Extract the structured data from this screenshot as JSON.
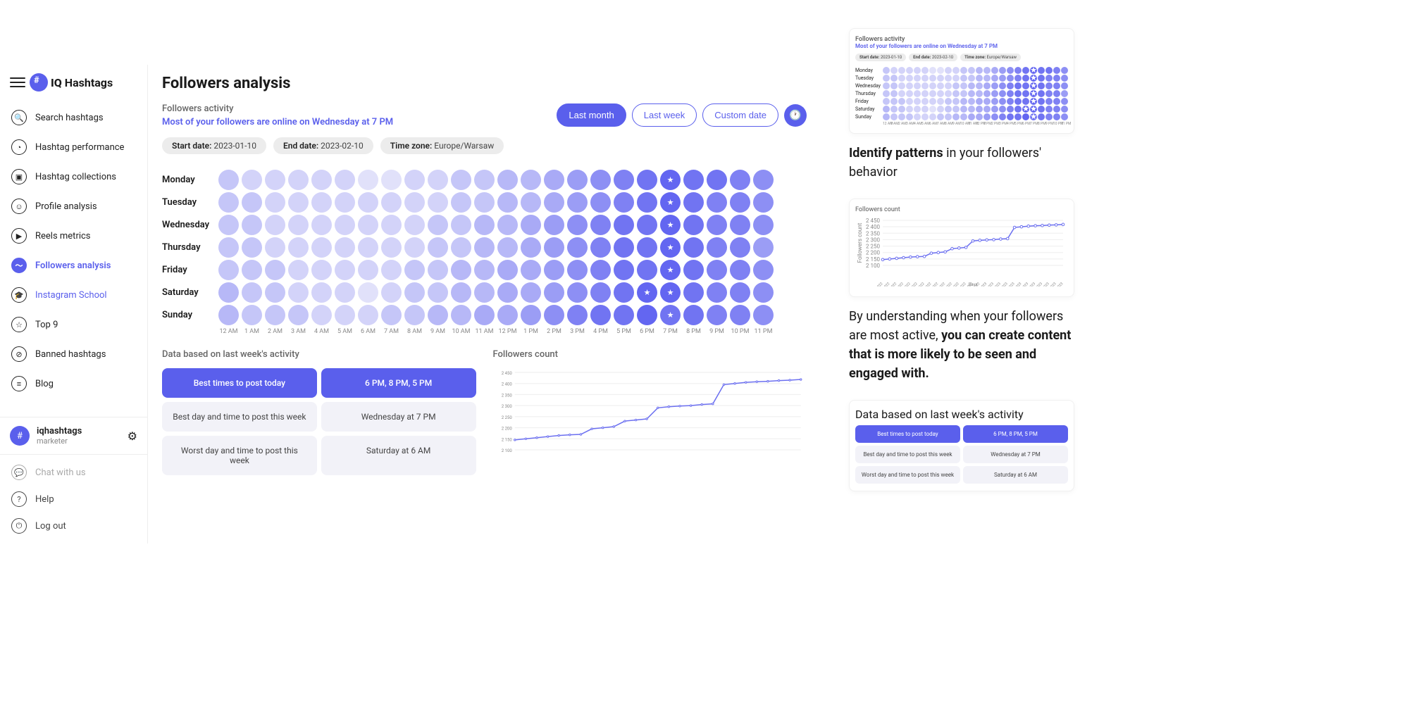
{
  "brand": {
    "name_part1": "IQ",
    "name_part2": "Hashtags"
  },
  "sidebar": {
    "items": [
      {
        "label": "Search hashtags",
        "icon": "🔍"
      },
      {
        "label": "Hashtag performance",
        "icon": "◔"
      },
      {
        "label": "Hashtag collections",
        "icon": "▣"
      },
      {
        "label": "Profile analysis",
        "icon": "☺"
      },
      {
        "label": "Reels metrics",
        "icon": "▶"
      },
      {
        "label": "Followers analysis",
        "icon": "〜"
      },
      {
        "label": "Instagram School",
        "icon": "🎓"
      },
      {
        "label": "Top 9",
        "icon": "☆"
      },
      {
        "label": "Banned hashtags",
        "icon": "⊘"
      },
      {
        "label": "Blog",
        "icon": "≡"
      }
    ],
    "user": {
      "name": "iqhashtags",
      "role": "marketer"
    },
    "footer": [
      {
        "label": "Chat with us",
        "icon": "💬"
      },
      {
        "label": "Help",
        "icon": "?"
      },
      {
        "label": "Log out",
        "icon": "⏻"
      }
    ]
  },
  "page": {
    "title": "Followers analysis",
    "activity_label": "Followers activity",
    "insight": "Most of your followers are online on Wednesday at 7 PM",
    "time_buttons": {
      "last_month": "Last month",
      "last_week": "Last week",
      "custom": "Custom date"
    },
    "pills": {
      "start_label": "Start date:",
      "start_val": "2023-01-10",
      "end_label": "End date:",
      "end_val": "2023-02-10",
      "tz_label": "Time zone:",
      "tz_val": "Europe/Warsaw"
    },
    "heatmap": {
      "days": [
        "Monday",
        "Tuesday",
        "Wednesday",
        "Thursday",
        "Friday",
        "Saturday",
        "Sunday"
      ],
      "hours": [
        "12 AM",
        "1 AM",
        "2 AM",
        "3 AM",
        "4 AM",
        "5 AM",
        "6 AM",
        "7 AM",
        "8 AM",
        "9 AM",
        "10 AM",
        "11 AM",
        "12 PM",
        "1 PM",
        "2 PM",
        "3 PM",
        "4 PM",
        "5 PM",
        "6 PM",
        "7 PM",
        "8 PM",
        "9 PM",
        "10 PM",
        "11 PM"
      ],
      "intensity": [
        [
          3,
          2,
          2,
          2,
          2,
          2,
          1,
          1,
          2,
          2,
          3,
          3,
          4,
          4,
          5,
          6,
          7,
          8,
          9,
          10,
          9,
          9,
          8,
          7
        ],
        [
          3,
          3,
          2,
          2,
          2,
          2,
          2,
          2,
          2,
          2,
          3,
          3,
          4,
          4,
          5,
          6,
          7,
          8,
          9,
          10,
          9,
          8,
          8,
          7
        ],
        [
          3,
          3,
          2,
          2,
          2,
          2,
          2,
          2,
          2,
          3,
          3,
          4,
          4,
          5,
          6,
          7,
          8,
          9,
          9,
          10,
          9,
          8,
          8,
          7
        ],
        [
          3,
          3,
          2,
          2,
          2,
          2,
          2,
          2,
          2,
          3,
          3,
          4,
          4,
          5,
          6,
          7,
          8,
          9,
          9,
          10,
          9,
          8,
          8,
          6
        ],
        [
          3,
          3,
          3,
          2,
          2,
          2,
          2,
          2,
          3,
          3,
          4,
          4,
          5,
          5,
          6,
          7,
          8,
          9,
          9,
          10,
          9,
          8,
          8,
          7
        ],
        [
          4,
          3,
          3,
          2,
          2,
          2,
          1,
          2,
          3,
          3,
          4,
          4,
          5,
          5,
          6,
          7,
          8,
          9,
          10,
          10,
          9,
          8,
          8,
          7
        ],
        [
          4,
          3,
          3,
          3,
          2,
          2,
          2,
          3,
          3,
          4,
          4,
          5,
          5,
          6,
          7,
          8,
          9,
          9,
          10,
          9,
          9,
          8,
          8,
          7
        ]
      ],
      "stars": [
        [
          19
        ],
        [
          19
        ],
        [
          19
        ],
        [
          19
        ],
        [
          19
        ],
        [
          18,
          19
        ],
        [
          19
        ]
      ]
    },
    "bottom": {
      "section_title": "Data based on last week's activity",
      "rows": [
        {
          "label": "Best times to post today",
          "value": "6 PM, 8 PM, 5 PM"
        },
        {
          "label": "Best day and time to post this week",
          "value": "Wednesday at 7 PM"
        },
        {
          "label": "Worst day and time to post this week",
          "value": "Saturday at 6 AM"
        }
      ],
      "followers_count_title": "Followers count"
    }
  },
  "chart_data": {
    "type": "line",
    "title": "Followers count",
    "xlabel": "Days",
    "ylabel": "Followers count",
    "x": [
      "05-11-2022",
      "07-11-2022",
      "11-11-2022",
      "15-11-2022",
      "19-11-2022",
      "23-11-2022",
      "27-11-2022",
      "01-12-2022",
      "05-12-2022",
      "09-12-2022",
      "13-12-2022",
      "17-12-2022",
      "21-12-2022",
      "25-12-2022",
      "29-12-2022",
      "02-01-2023",
      "06-01-2023",
      "10-01-2023",
      "14-01-2023",
      "18-01-2023",
      "22-01-2023",
      "26-01-2023",
      "30-01-2023",
      "03-02-2023",
      "07-02-2023",
      "11-02-2023",
      "15-02-2023"
    ],
    "values": [
      2145,
      2150,
      2155,
      2160,
      2165,
      2168,
      2170,
      2195,
      2200,
      2205,
      2230,
      2235,
      2240,
      2290,
      2295,
      2298,
      2300,
      2305,
      2308,
      2395,
      2400,
      2405,
      2408,
      2410,
      2413,
      2415,
      2418
    ],
    "ylim": [
      2100,
      2450
    ],
    "yticks": [
      2100,
      2150,
      2200,
      2250,
      2300,
      2350,
      2400,
      2450
    ]
  },
  "marketing": {
    "headline1_bold": "Identify patterns",
    "headline1_rest": " in your followers' behavior",
    "para_lead": "By understanding when your followers are most active, ",
    "para_bold": "you can create content that is more likely to be seen and engaged with."
  }
}
